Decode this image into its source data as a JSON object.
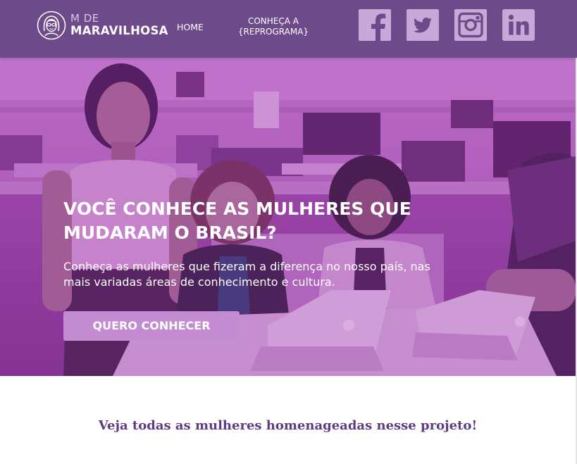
{
  "header": {
    "logo": {
      "small": "M DE",
      "big": "MARAVILHOSA"
    },
    "nav": {
      "home": "HOME",
      "conheca_line1": "CONHEÇA A",
      "conheca_line2": "{REPROGRAMA}"
    },
    "social": [
      {
        "icon": "facebook-icon"
      },
      {
        "icon": "twitter-icon"
      },
      {
        "icon": "instagram-icon"
      },
      {
        "icon": "linkedin-icon"
      }
    ]
  },
  "hero": {
    "title_line1": "VOCÊ CONHECE AS MULHERES QUE",
    "title_line2": "MUDARAM O BRASIL?",
    "subtitle_line1": "Conheça as mulheres que fizeram a diferença no nosso país, nas",
    "subtitle_line2": "mais variadas áreas de conhecimento e cultura.",
    "cta": "QUERO CONHECER"
  },
  "content": {
    "section_title": "Veja todas as mulheres homenageadas nesse projeto!"
  },
  "colors": {
    "header_bg": "#6d4a8a",
    "hero_tint": "#9d4cab",
    "button": "#c48cd0",
    "section_title": "#5e3c82",
    "social_icon": "#c7a8d8"
  }
}
